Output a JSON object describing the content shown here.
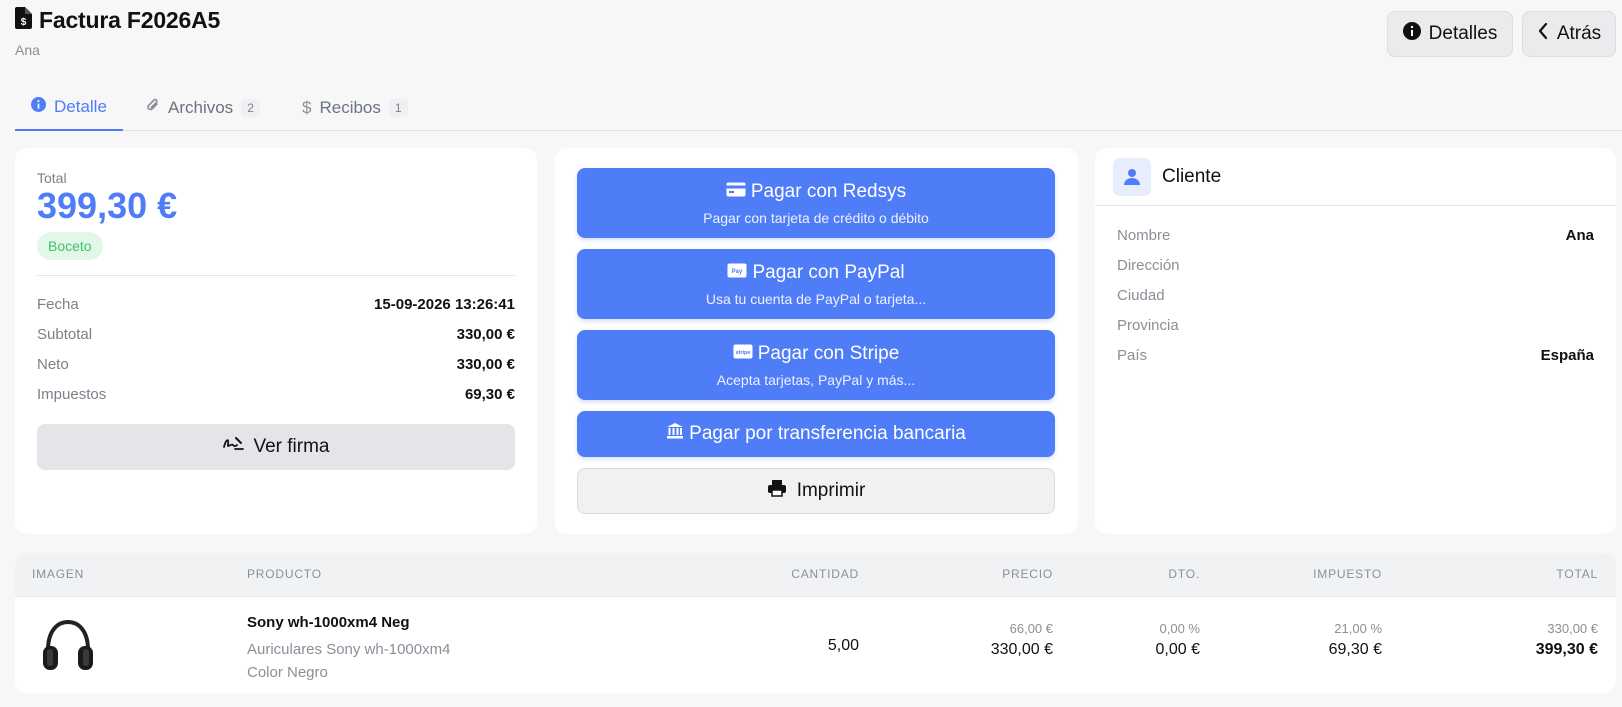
{
  "header": {
    "title": "Factura F2026A5",
    "subtitle": "Ana",
    "details_label": "Detalles",
    "back_label": "Atrás"
  },
  "tabs": [
    {
      "label": "Detalle",
      "active": true
    },
    {
      "label": "Archivos",
      "count": "2"
    },
    {
      "label": "Recibos",
      "count": "1"
    }
  ],
  "summary": {
    "total_label": "Total",
    "total_value": "399,30 €",
    "status": "Boceto",
    "rows": [
      {
        "label": "Fecha",
        "value": "15-09-2026 13:26:41"
      },
      {
        "label": "Subtotal",
        "value": "330,00 €"
      },
      {
        "label": "Neto",
        "value": "330,00 €"
      },
      {
        "label": "Impuestos",
        "value": "69,30 €"
      }
    ],
    "signature_label": "Ver firma"
  },
  "payments": {
    "redsys": {
      "title": "Pagar con Redsys",
      "subtitle": "Pagar con tarjeta de crédito o débito"
    },
    "paypal": {
      "title": "Pagar con PayPal",
      "subtitle": "Usa tu cuenta de PayPal o tarjeta..."
    },
    "stripe": {
      "title": "Pagar con Stripe",
      "subtitle": "Acepta tarjetas, PayPal y más..."
    },
    "transfer": {
      "title": "Pagar por transferencia bancaria"
    },
    "print_label": "Imprimir"
  },
  "client": {
    "title": "Cliente",
    "rows": [
      {
        "label": "Nombre",
        "value": "Ana"
      },
      {
        "label": "Dirección",
        "value": ""
      },
      {
        "label": "Ciudad",
        "value": ""
      },
      {
        "label": "Provincia",
        "value": ""
      },
      {
        "label": "País",
        "value": "España"
      }
    ]
  },
  "table": {
    "headers": [
      "IMAGEN",
      "PRODUCTO",
      "CANTIDAD",
      "PRECIO",
      "DTO.",
      "IMPUESTO",
      "TOTAL"
    ],
    "rows": [
      {
        "image_icon": "headphones-icon",
        "name": "Sony wh-1000xm4 Neg",
        "description": "Auriculares Sony wh-1000xm4\nColor Negro",
        "quantity": "5,00",
        "unit_price": "66,00 €",
        "price": "330,00 €",
        "discount_pct": "0,00 %",
        "discount": "0,00 €",
        "tax_pct": "21,00 %",
        "tax": "69,30 €",
        "unit_total": "330,00 €",
        "total": "399,30 €"
      }
    ]
  },
  "colors": {
    "accent": "#4f7cf7",
    "success": "#3ec36b"
  }
}
